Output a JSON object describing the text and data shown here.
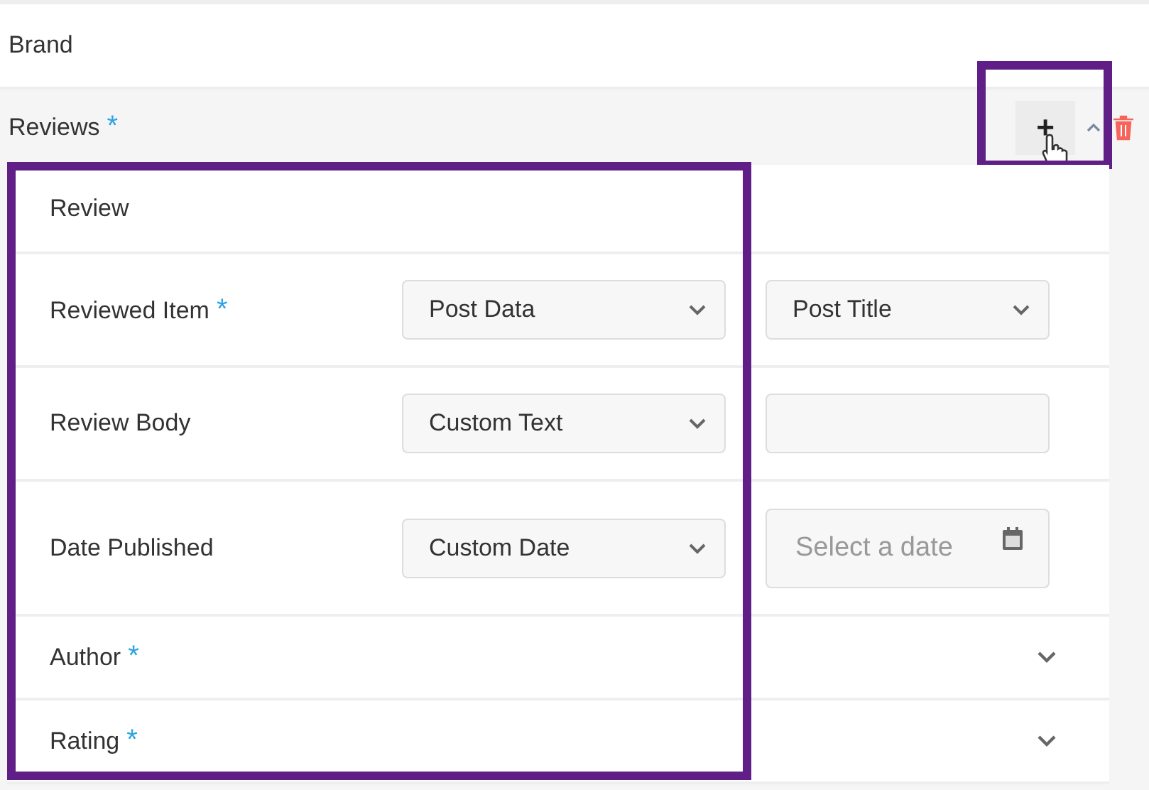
{
  "brand": {
    "label": "Brand"
  },
  "reviews": {
    "label": "Reviews",
    "required_mark": "*",
    "add_button": {
      "label": "+",
      "highlighted": true,
      "hovered": true
    }
  },
  "review_card": {
    "title": "Review",
    "highlighted": true,
    "rows": [
      {
        "kind": "select",
        "label": "Reviewed Item",
        "required_mark": "*",
        "source": "Post Data",
        "field": {
          "kind": "select",
          "value": "Post Title"
        }
      },
      {
        "kind": "select",
        "label": "Review Body",
        "source": "Custom Text",
        "field": {
          "kind": "text"
        }
      },
      {
        "kind": "select",
        "label": "Date Published",
        "source": "Custom Date",
        "field": {
          "kind": "date",
          "placeholder": "Select a date"
        }
      },
      {
        "kind": "collapsed",
        "label": "Author",
        "required_mark": "*"
      },
      {
        "kind": "collapsed",
        "label": "Rating",
        "required_mark": "*"
      }
    ]
  }
}
